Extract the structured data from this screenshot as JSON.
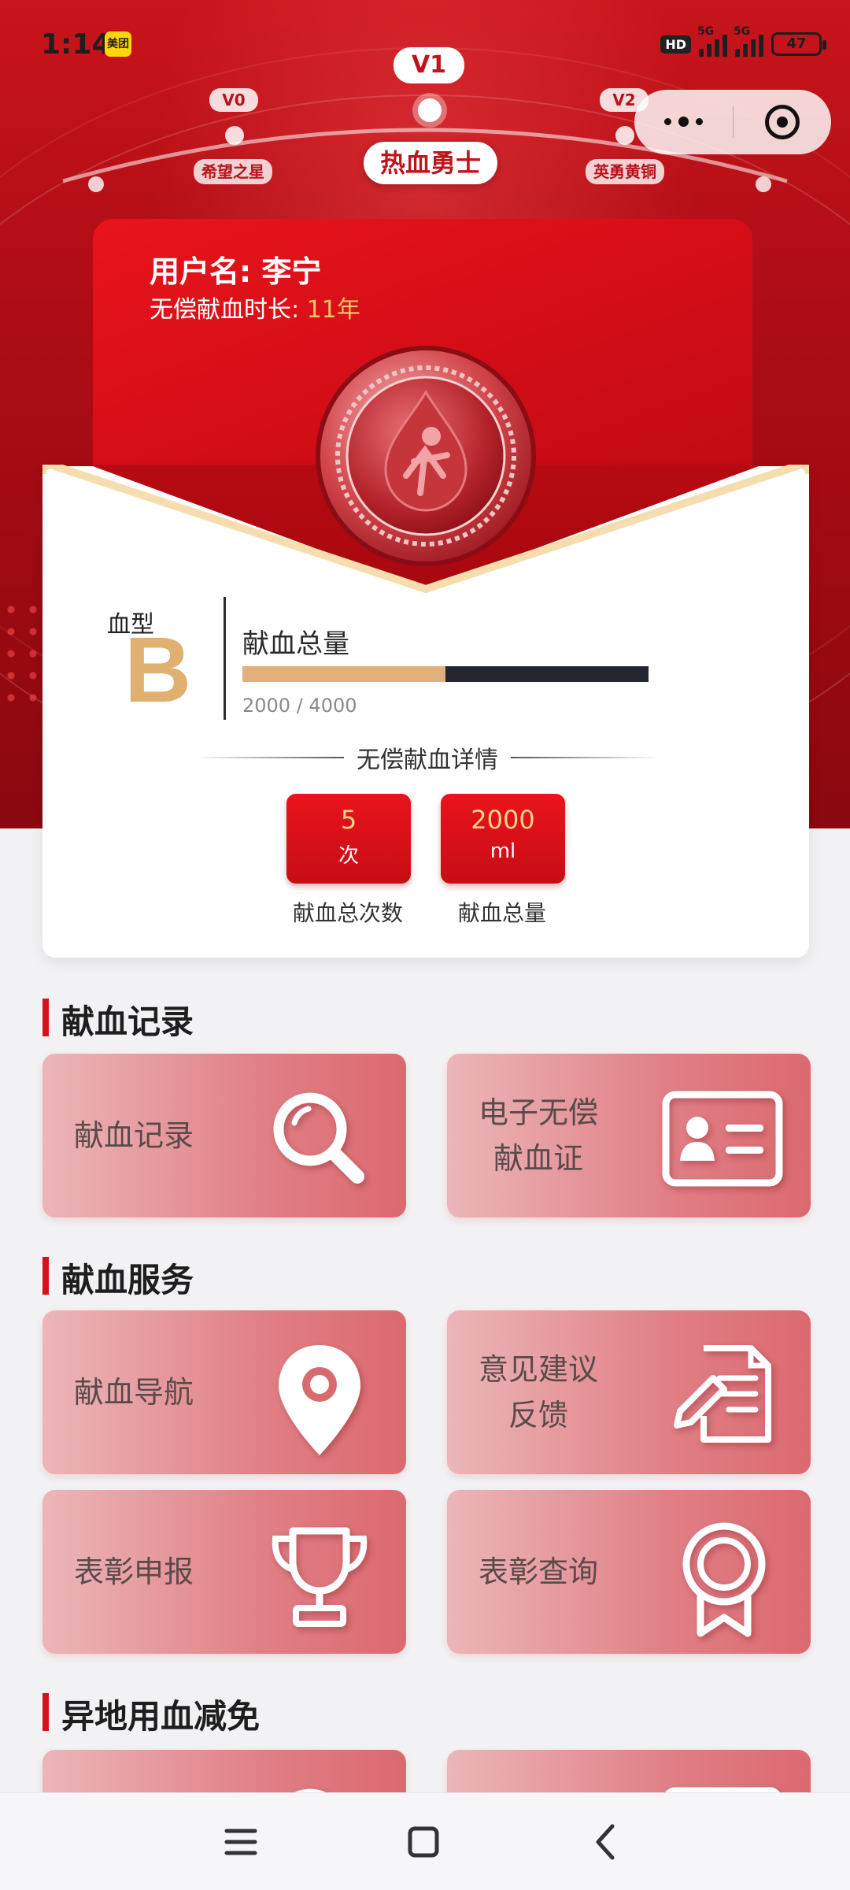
{
  "status_bar": {
    "time": "1:14",
    "app_badge": "美团",
    "hd": "HD",
    "net1": "5G",
    "net2": "5G",
    "battery": "47"
  },
  "levels": {
    "prev_code": "V0",
    "prev_name": "希望之星",
    "current_code": "V1",
    "current_name": "热血勇士",
    "next_code": "V2",
    "next_name": "英勇黄铜"
  },
  "profile": {
    "name_line": "用户名: 李宁",
    "years_prefix": "无偿献血时长:",
    "years_value": "11年"
  },
  "blood": {
    "type_label": "血型",
    "type": "B",
    "total_title": "献血总量",
    "progress_text": "2000 / 4000",
    "progress_fraction": 0.5,
    "detail_title": "无偿献血详情"
  },
  "stats": [
    {
      "value": "5",
      "unit": "次",
      "label": "献血总次数"
    },
    {
      "value": "2000",
      "unit": "ml",
      "label": "献血总量"
    }
  ],
  "sections": {
    "records_title": "献血记录",
    "services_title": "献血服务",
    "remote_title": "异地用血减免"
  },
  "tiles": {
    "record": "献血记录",
    "certificate_line1": "电子无偿",
    "certificate_line2": "献血证",
    "navigation": "献血导航",
    "feedback_line1": "意见建议",
    "feedback_line2": "反馈",
    "commend_apply": "表彰申报",
    "commend_query": "表彰查询"
  },
  "colors": {
    "brand_red": "#d3121b",
    "gold": "#e0b070",
    "progress_bg": "#23252f"
  }
}
